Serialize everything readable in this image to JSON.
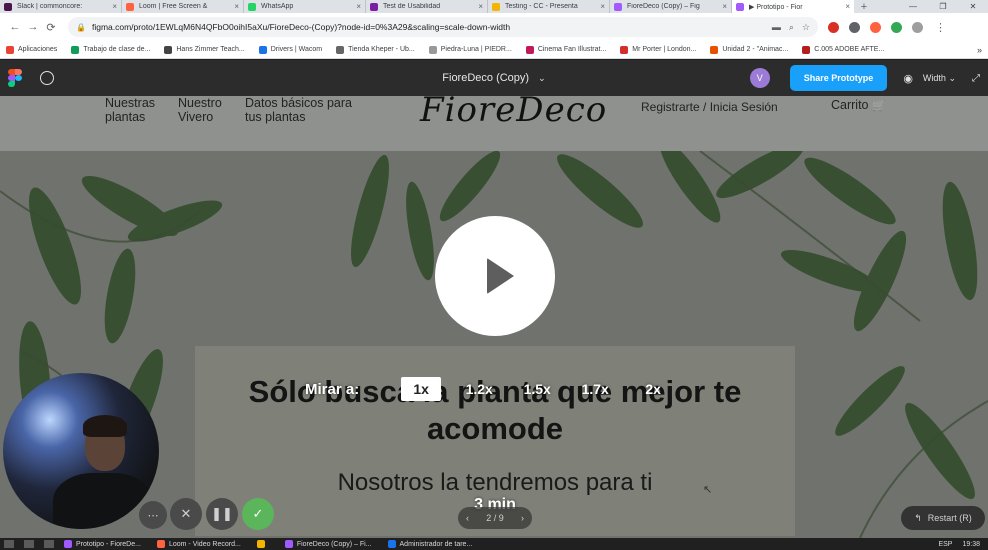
{
  "browser": {
    "tabs": [
      {
        "title": "Slack | commoncore:",
        "color": "#4a154b"
      },
      {
        "title": "Loom | Free Screen &",
        "color": "#ff623e"
      },
      {
        "title": "WhatsApp",
        "color": "#25d366"
      },
      {
        "title": "Test de Usabilidad",
        "color": "#7a1fa2"
      },
      {
        "title": "Testing - CC - Presenta",
        "color": "#f4b400"
      },
      {
        "title": "FioreDeco (Copy) – Fig",
        "color": "#a259ff"
      },
      {
        "title": "▶ Prototipo - Fior",
        "color": "#a259ff",
        "active": true
      }
    ],
    "close_glyph": "×",
    "new_tab_glyph": "+",
    "window_controls": [
      "—",
      "❐",
      "✕"
    ],
    "url": "figma.com/proto/1EWLqM6N4QFbO0oihI5aXu/FioreDeco-(Copy)?node-id=0%3A29&scaling=scale-down-width",
    "bookmarks": [
      {
        "label": "Aplicaciones",
        "color": "#ea4335"
      },
      {
        "label": "Trabajo de clase de...",
        "color": "#0f9d58"
      },
      {
        "label": "Hans Zimmer Teach...",
        "color": "#444444"
      },
      {
        "label": "Drivers | Wacom",
        "color": "#1a73e8"
      },
      {
        "label": "Tienda Kheper - Ub...",
        "color": "#666666"
      },
      {
        "label": "Piedra-Luna | PIEDR...",
        "color": "#999999"
      },
      {
        "label": "Cinema Fan Illustrat...",
        "color": "#c2185b"
      },
      {
        "label": "Mr Porter | London...",
        "color": "#d32f2f"
      },
      {
        "label": "Unidad 2 - \"Animac...",
        "color": "#e65100"
      },
      {
        "label": "C.005 ADOBE AFTE...",
        "color": "#b71c1c"
      }
    ],
    "bookmarks_more": "»"
  },
  "figma": {
    "file_title": "FioreDeco (Copy)",
    "file_title_chevron": "⌄",
    "avatar_initial": "V",
    "share_label": "Share Prototype",
    "width_label": "Width",
    "width_chevron": "⌄",
    "logo_colors": [
      "#f24e1e",
      "#ff7262",
      "#a259ff",
      "#1abcfe",
      "#0acf83"
    ]
  },
  "site": {
    "nav": [
      "Nuestras plantas",
      "Nuestro Vivero",
      "Datos básicos para tus plantas"
    ],
    "logo": "FioreDeco",
    "register_link": "Registrarte / Inicia Sesión",
    "cart_link": "Carrito",
    "cart_icon": "🛒",
    "hero_title": "Sólo busca la planta que mejor te acomode",
    "hero_subtitle": "Nosotros la tendremos para ti"
  },
  "loom": {
    "speed_label": "Mirar a:",
    "speeds": [
      "1x",
      "1.2x",
      "1.5x",
      "1.7x",
      "2x"
    ],
    "selected_speed": "1x",
    "duration": "3 min",
    "pager": "2 / 9",
    "restart_label": "Restart (R)",
    "restart_icon": "↰",
    "pager_prev": "‹",
    "pager_next": "›"
  },
  "taskbar": {
    "apps": [
      {
        "label": "Prototipo - FioreDe...",
        "color": "#a259ff"
      },
      {
        "label": "Loom - Video Record...",
        "color": "#ff623e"
      },
      {
        "label": "",
        "color": "#f4b400"
      },
      {
        "label": "FioreDeco (Copy) – Fi...",
        "color": "#a259ff"
      },
      {
        "label": "Administrador de tare...",
        "color": "#1a73e8"
      }
    ],
    "lang": "ESP",
    "time": "19:38"
  }
}
